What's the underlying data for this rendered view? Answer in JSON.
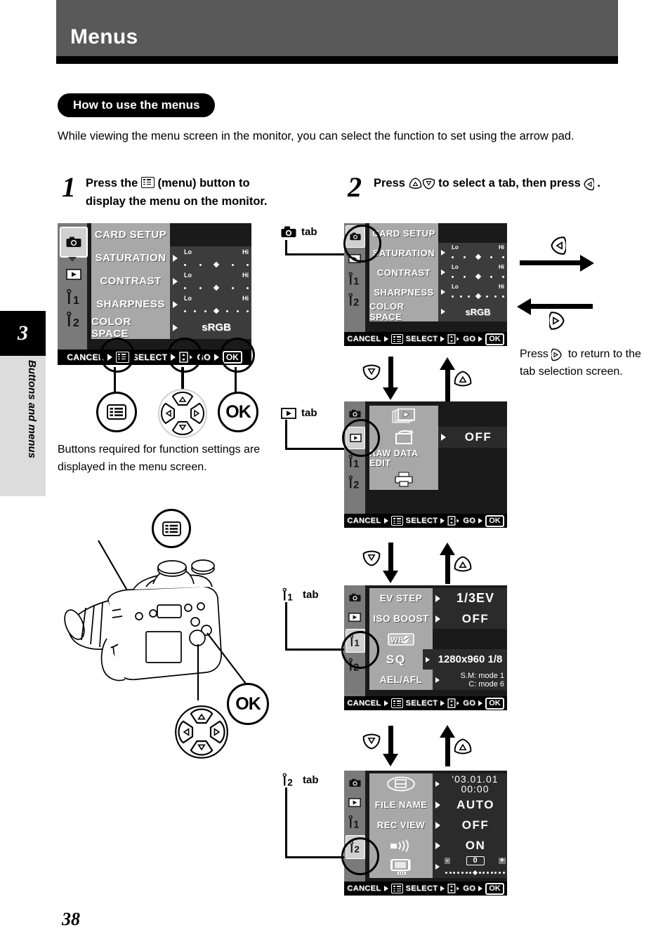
{
  "header": {
    "title": "Menus",
    "band_color": "#595959"
  },
  "chapter": {
    "number": "3",
    "label": "Buttons and menus"
  },
  "section": {
    "title": "How to use the menus"
  },
  "intro": "While viewing the menu screen in the monitor, you can select the function to set using the arrow pad.",
  "steps": [
    {
      "number": "1",
      "text_before": "Press the",
      "icon": "menu-button-icon",
      "text_after": "(menu) button to display the menu on the monitor."
    },
    {
      "number": "2",
      "text_before": "Press",
      "icons": [
        "arrow-up-key-icon",
        "arrow-down-key-icon"
      ],
      "text_mid": "to select a tab, then press",
      "icon_end": "arrow-right-key-icon",
      "text_after": "."
    }
  ],
  "buttons_note": "Buttons required for function settings are displayed in the menu screen.",
  "callouts": {
    "ok_label": "OK",
    "menu_icon": "menu-button-icon",
    "arrow_pad_icon": "arrow-pad-icon"
  },
  "return_note": {
    "before": "Press",
    "icon": "arrow-left-key-icon",
    "after": "to return to the tab selection screen."
  },
  "status_bar": {
    "cancel": "CANCEL",
    "select": "SELECT",
    "go": "GO",
    "ok": "OK"
  },
  "tab_captions": [
    {
      "icon": "camera-tab-icon",
      "label": "tab"
    },
    {
      "icon": "playback-tab-icon",
      "label": "tab"
    },
    {
      "icon": "wrench1-tab-icon",
      "label": "tab"
    },
    {
      "icon": "wrench2-tab-icon",
      "label": "tab"
    }
  ],
  "screens": {
    "step1_screen": {
      "active_tab": "camera",
      "tabs": [
        "camera-tab-icon",
        "playback-tab-icon",
        "wrench1-tab-icon",
        "wrench2-tab-icon"
      ],
      "rows": [
        {
          "label": "CARD SETUP",
          "value_type": "none",
          "value": ""
        },
        {
          "label": "SATURATION",
          "value_type": "slider",
          "lo": "Lo",
          "hi": "Hi",
          "dots": 5,
          "marker_index": 2
        },
        {
          "label": "CONTRAST",
          "value_type": "slider",
          "lo": "Lo",
          "hi": "Hi",
          "dots": 5,
          "marker_index": 2
        },
        {
          "label": "SHARPNESS",
          "value_type": "slider",
          "lo": "Lo",
          "hi": "Hi",
          "dots": 7,
          "marker_index": 3
        },
        {
          "label": "COLOR SPACE",
          "value_type": "text",
          "value": "sRGB"
        }
      ]
    },
    "camera_screen": {
      "active_tab": "camera",
      "rows": [
        {
          "label": "CARD SETUP",
          "value_type": "none",
          "value": ""
        },
        {
          "label": "SATURATION",
          "value_type": "slider",
          "lo": "Lo",
          "hi": "Hi",
          "dots": 5,
          "marker_index": 2
        },
        {
          "label": "CONTRAST",
          "value_type": "slider",
          "lo": "Lo",
          "hi": "Hi",
          "dots": 5,
          "marker_index": 2
        },
        {
          "label": "SHARPNESS",
          "value_type": "slider",
          "lo": "Lo",
          "hi": "Hi",
          "dots": 7,
          "marker_index": 3
        },
        {
          "label": "COLOR SPACE",
          "value_type": "text",
          "value": "sRGB"
        }
      ]
    },
    "playback_screen": {
      "active_tab": "playback",
      "rows": [
        {
          "label": "",
          "icon": "slideshow-icon",
          "value_type": "none",
          "value": ""
        },
        {
          "label": "",
          "icon": "rotate-icon",
          "value_type": "text",
          "value": "OFF"
        },
        {
          "label": "RAW DATA EDIT",
          "value_type": "none",
          "value": ""
        },
        {
          "label": "",
          "icon": "print-icon",
          "value_type": "none",
          "value": ""
        }
      ]
    },
    "wrench1_screen": {
      "active_tab": "wrench1",
      "rows": [
        {
          "label": "EV STEP",
          "value_type": "text",
          "value": "1/3EV"
        },
        {
          "label": "ISO BOOST",
          "value_type": "text",
          "value": "OFF"
        },
        {
          "label": "",
          "icon": "wb-adjust-icon",
          "value_type": "none",
          "value": ""
        },
        {
          "label": "SQ",
          "value_type": "text",
          "value": "1280x960 1/8"
        },
        {
          "label": "AEL/AFL",
          "value_type": "text2",
          "value": "S.M: mode 1",
          "value2": "C: mode 6"
        }
      ]
    },
    "wrench2_screen": {
      "active_tab": "wrench2",
      "rows": [
        {
          "label": "",
          "icon": "clock-icon",
          "value_type": "text2",
          "value": "'03.01.01",
          "value2": "00:00"
        },
        {
          "label": "FILE NAME",
          "value_type": "text",
          "value": "AUTO"
        },
        {
          "label": "REC VIEW",
          "value_type": "text",
          "value": "OFF"
        },
        {
          "label": "",
          "icon": "beep-icon",
          "value_type": "text",
          "value": "ON"
        },
        {
          "label": "",
          "icon": "monitor-brightness-icon",
          "value_type": "scale",
          "value": "0",
          "minus": "-",
          "plus": "+"
        }
      ]
    }
  },
  "page_number": "38"
}
